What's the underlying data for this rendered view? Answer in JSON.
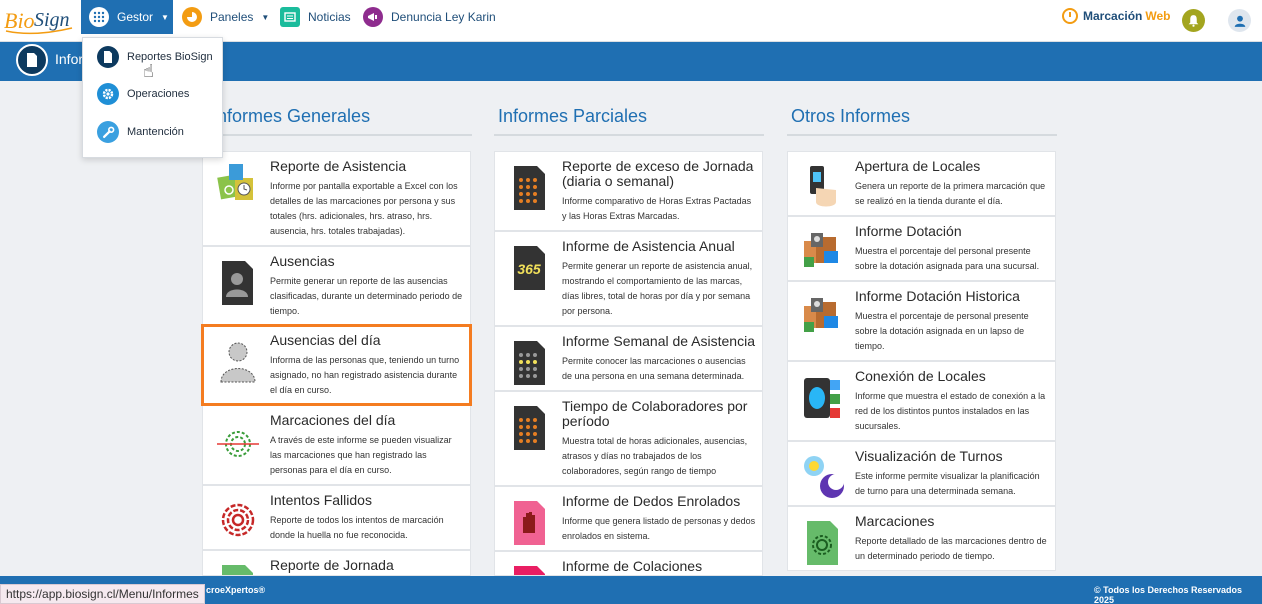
{
  "brand": {
    "logo_text": "BioSign"
  },
  "nav": {
    "gestor": "Gestor",
    "paneles": "Paneles",
    "noticias": "Noticias",
    "denuncia": "Denuncia Ley Karin",
    "marcacion": "Marcación",
    "marcacion_web": "Web"
  },
  "band": {
    "title": "Informes"
  },
  "dropdown": {
    "items": [
      {
        "label": "Reportes BioSign"
      },
      {
        "label": "Operaciones"
      },
      {
        "label": "Mantención"
      }
    ]
  },
  "columns": [
    {
      "title": "Informes Generales",
      "cards": [
        {
          "title": "Reporte de Asistencia",
          "desc": "Informe por pantalla exportable a Excel con los detalles de las marcaciones por persona y sus totales (hrs. adicionales, hrs. atraso, hrs. ausencia, hrs. totales trabajadas).",
          "icon": "calendar-clock-fingerprint-icon"
        },
        {
          "title": "Ausencias",
          "desc": "Permite generar un reporte de las ausencias clasificadas, durante un determinado periodo de tiempo.",
          "icon": "person-document-icon"
        },
        {
          "title": "Ausencias del día",
          "desc": "Informa de las personas que, teniendo un turno asignado, no han registrado asistencia durante el día en curso.",
          "icon": "absent-person-icon"
        },
        {
          "title": "Marcaciones del día",
          "desc": "A través de este informe se pueden visualizar las marcaciones que han registrado las personas para el día en curso.",
          "icon": "fingerprint-scan-icon"
        },
        {
          "title": "Intentos Fallidos",
          "desc": "Reporte de todos los intentos de marcación donde la huella no fue reconocida.",
          "icon": "red-fingerprint-icon"
        },
        {
          "title": "Reporte de Jornada",
          "desc": "",
          "icon": "green-document-icon"
        }
      ]
    },
    {
      "title": "Informes Parciales",
      "cards": [
        {
          "title": "Reporte de exceso de Jornada (diaria o semanal)",
          "desc": "Informe comparativo de Horas Extras Pactadas y las Horas Extras Marcadas.",
          "icon": "calculator-document-icon"
        },
        {
          "title": "Informe de Asistencia Anual",
          "desc": "Permite generar un reporte de asistencia anual, mostrando el comportamiento de las marcas, días libres, total de horas por día y por semana por persona.",
          "icon": "365-document-icon",
          "badge": "365"
        },
        {
          "title": "Informe Semanal de Asistencia",
          "desc": "Permite conocer las marcaciones o ausencias de una persona en una semana determinada.",
          "icon": "calculator-document-icon"
        },
        {
          "title": "Tiempo de Colaboradores por período",
          "desc": "Muestra total de horas adicionales, ausencias, atrasos y días no trabajados de los colaboradores, según rango de tiempo",
          "icon": "calculator-document-icon"
        },
        {
          "title": "Informe de Dedos Enrolados",
          "desc": "Informe que genera listado de personas y dedos enrolados en sistema.",
          "icon": "hand-document-icon"
        },
        {
          "title": "Informe de Colaciones",
          "desc": "",
          "icon": "pink-document-icon"
        }
      ]
    },
    {
      "title": "Otros Informes",
      "cards": [
        {
          "title": "Apertura de Locales",
          "desc": "Genera un reporte de la primera marcación que se realizó en la tienda durante el día.",
          "icon": "hand-device-icon"
        },
        {
          "title": "Informe Dotación",
          "desc": "Muestra el porcentaje del personal presente sobre la dotación asignada para una sucursal.",
          "icon": "staff-folder-icon"
        },
        {
          "title": "Informe Dotación Historica",
          "desc": "Muestra el porcentaje de personal presente sobre la dotación asignada en un lapso de tiempo.",
          "icon": "staff-folder-icon"
        },
        {
          "title": "Conexión de Locales",
          "desc": "Informe que muestra el estado de conexión a la red de los distintos puntos instalados en las sucursales.",
          "icon": "device-status-icon"
        },
        {
          "title": "Visualización de Turnos",
          "desc": "Este informe permite visualizar la planificación de turno para una determinada semana.",
          "icon": "sun-moon-icon"
        },
        {
          "title": "Marcaciones",
          "desc": "Reporte detallado de las marcaciones dentro de un determinado periodo de tiempo.",
          "icon": "green-fingerprint-document-icon"
        }
      ]
    }
  ],
  "footer": {
    "left": "croeXpertos®",
    "right": "© Todos los Derechos Reservados 2025"
  },
  "status_bar": {
    "url": "https://app.biosign.cl/Menu/Informes"
  },
  "colors": {
    "primary": "#1f6fb2",
    "accent": "#f39c12",
    "highlight": "#f47c20"
  }
}
